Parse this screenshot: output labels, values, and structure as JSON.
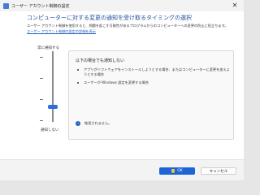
{
  "window": {
    "title": "ユーザー アカウント制御の設定",
    "close_glyph": "✕"
  },
  "header": {
    "heading": "コンピューターに対する変更の通知を受け取るタイミングの選択",
    "description": "ユーザー アカウント制御を使用すると、問題を起こす可能性があるプログラムからのコンピューターへの変更の防止に役立ちます。",
    "link": "ユーザー アカウント制御の設定の詳細を表示"
  },
  "slider": {
    "top_label": "常に通知する",
    "bottom_label": "通知しない",
    "level": 0.75
  },
  "info": {
    "title": "以下の場合でも通知しない",
    "bullets": [
      "アプリがソフトウェアをインストールしようとする場合、またはコンピューターに変更を加えようとする場合",
      "ユーザーが Windows 設定を変更する場合"
    ],
    "status_icon": "info-icon",
    "status": "推奨されません。"
  },
  "buttons": {
    "ok": "OK",
    "cancel": "キャンセル"
  }
}
